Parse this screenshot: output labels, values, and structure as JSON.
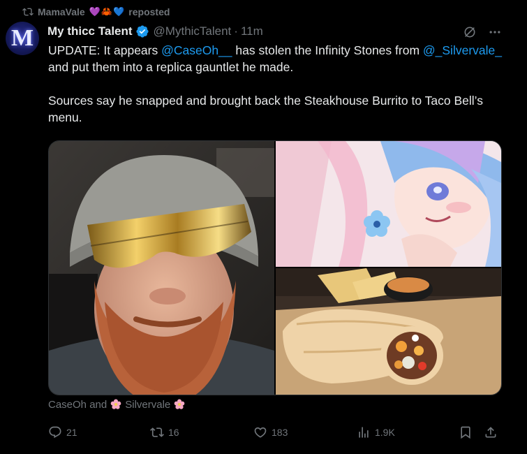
{
  "repost": {
    "user": "MamaVale",
    "label": "reposted",
    "emojis": [
      "💜",
      "🦀",
      "💙"
    ]
  },
  "tweet": {
    "display_name": "My thicc Talent",
    "handle": "@MythicTalent",
    "separator": "·",
    "time": "11m",
    "text": {
      "p1_a": "UPDATE: It appears ",
      "mention1": "@CaseOh__",
      "p1_b": " has stolen the Infinity Stones from ",
      "mention2": "@_Silvervale_",
      "p1_c": " and put them into a replica gauntlet he made.",
      "p2": "Sources say he snapped and brought back the Steakhouse Burrito to Taco Bell’s menu."
    },
    "tagged": {
      "a": "CaseOh and",
      "b": "Silvervale"
    }
  },
  "actions": {
    "replies": "21",
    "reposts": "16",
    "likes": "183",
    "views": "1.9K"
  },
  "colors": {
    "accent": "#1d9bf0",
    "muted": "#71767b",
    "text": "#e7e9ea",
    "bg": "#000000"
  }
}
